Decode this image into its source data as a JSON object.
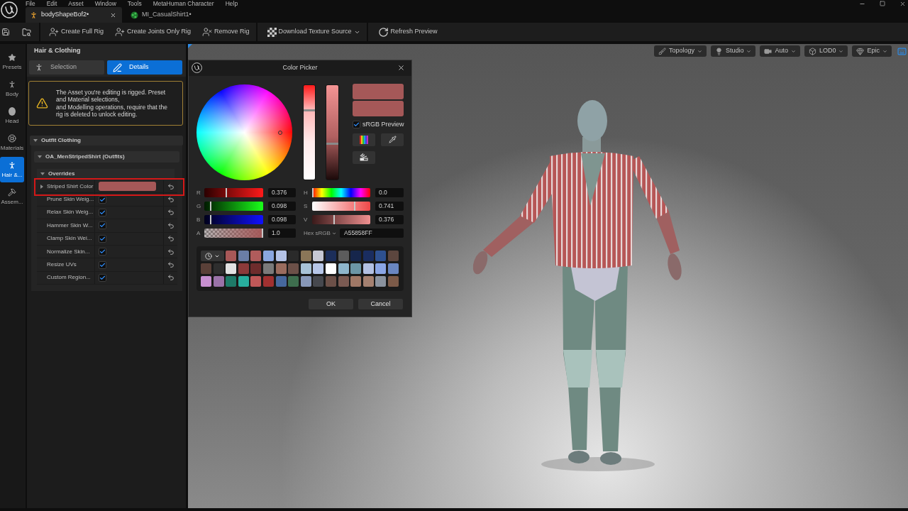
{
  "menu_bar": [
    "File",
    "Edit",
    "Asset",
    "Window",
    "Tools",
    "MetaHuman Character",
    "Help"
  ],
  "document_tabs": [
    {
      "label": "bodyShapeBof2•",
      "kind": "character",
      "selected": true
    },
    {
      "label": "MI_CasualShirt1•",
      "kind": "material",
      "selected": false
    }
  ],
  "toolbar_groups": [
    {
      "buttons": [
        {
          "label": "Create Full Rig",
          "kind": "add_rig"
        },
        {
          "label": "Create Joints Only Rig",
          "kind": "add_rig"
        },
        {
          "label": "Remove Rig",
          "kind": "remove_rig"
        }
      ]
    },
    {
      "buttons": [
        {
          "label": "Download Texture Source",
          "kind": "texture_dropdown"
        }
      ]
    },
    {
      "buttons": [
        {
          "label": "Refresh Preview",
          "kind": "refresh"
        }
      ]
    }
  ],
  "mode_sidebar": [
    {
      "label": "Presets",
      "kind": "presets",
      "selected": false
    },
    {
      "label": "Body",
      "kind": "body",
      "selected": false
    },
    {
      "label": "Head",
      "kind": "head",
      "selected": false
    },
    {
      "label": "Materials",
      "kind": "materials",
      "selected": false
    },
    {
      "label": "Hair &...",
      "kind": "hair_clothing",
      "selected": true
    },
    {
      "label": "Assem...",
      "kind": "assembly",
      "selected": false
    }
  ],
  "panel": {
    "title": "Hair & Clothing",
    "tabs": [
      {
        "label": "Selection",
        "kind": "selection",
        "selected": false
      },
      {
        "label": "Details",
        "kind": "details",
        "selected": true
      }
    ],
    "warning": "The Asset you're editing is rigged. Preset and Material selections,\nand Modelling operations, require that the rig is deleted to unlock editing.",
    "categories": [
      {
        "label": "Outfit Clothing",
        "expanded": true,
        "children": [
          {
            "label": "OA_MenStripedShirt (Outfits)",
            "expanded": true,
            "children": [
              {
                "label": "Overrides",
                "expanded": true,
                "properties": [
                  {
                    "label": "Striped Shirt Color",
                    "kind": "color",
                    "color": "#a55858",
                    "expanded": false,
                    "highlighted": true
                  },
                  {
                    "label": "Prune Skin Weig...",
                    "kind": "checkbox",
                    "checked": true,
                    "highlighted": false
                  },
                  {
                    "label": "Relax Skin Weig...",
                    "kind": "checkbox",
                    "checked": true,
                    "highlighted": false
                  },
                  {
                    "label": "Hammer Skin W...",
                    "kind": "checkbox",
                    "checked": true,
                    "highlighted": false
                  },
                  {
                    "label": "Clamp Skin Wei...",
                    "kind": "checkbox",
                    "checked": true,
                    "highlighted": false
                  },
                  {
                    "label": "Normalize Skin...",
                    "kind": "checkbox",
                    "checked": true,
                    "highlighted": false
                  },
                  {
                    "label": "Resize UVs",
                    "kind": "checkbox",
                    "checked": true,
                    "highlighted": false
                  },
                  {
                    "label": "Custom Region...",
                    "kind": "checkbox",
                    "checked": true,
                    "highlighted": false
                  }
                ]
              }
            ]
          }
        ]
      }
    ]
  },
  "viewport": {
    "toolbar": [
      {
        "label": "Topology",
        "kind": "topology"
      },
      {
        "label": "Studio",
        "kind": "lighting"
      },
      {
        "label": "Auto",
        "kind": "camera"
      },
      {
        "label": "LOD0",
        "kind": "lod"
      },
      {
        "label": "Epic",
        "kind": "quality"
      }
    ]
  },
  "color_picker": {
    "title": "Color Picker",
    "saturation_bar": {
      "level": 0.741
    },
    "value_bar": {
      "level": 0.376
    },
    "previews": [
      {
        "color": "#a55858"
      },
      {
        "color": "#a55858"
      }
    ],
    "srgb_preview": {
      "label": "sRGB Preview",
      "checked": true
    },
    "rgba_sliders": [
      {
        "label": "R",
        "kind": "red",
        "level": 0.376,
        "value": "0.376"
      },
      {
        "label": "G",
        "kind": "green",
        "level": 0.098,
        "value": "0.098"
      },
      {
        "label": "B",
        "kind": "blue",
        "level": 0.098,
        "value": "0.098"
      },
      {
        "label": "A",
        "kind": "alpha",
        "level": 1.0,
        "value": "1.0"
      }
    ],
    "hsv_sliders": [
      {
        "label": "H",
        "kind": "hue",
        "level": 0.0,
        "value": "0.0"
      },
      {
        "label": "S",
        "kind": "saturation",
        "level": 0.741,
        "value": "0.741"
      },
      {
        "label": "V",
        "kind": "value",
        "level": 0.376,
        "value": "0.376"
      }
    ],
    "hex": {
      "label": "Hex sRGB",
      "value": "A55858FF"
    },
    "swatches": [
      {
        "color": "#a85858"
      },
      {
        "color": "#6a7ea6"
      },
      {
        "color": "#b05c5c"
      },
      {
        "color": "#8aa6e0"
      },
      {
        "color": "#b4c2e6"
      },
      {
        "color": "#2a2a2a"
      },
      {
        "color": "#8a7658"
      },
      {
        "color": "#c6c8d4"
      },
      {
        "color": "#1c2e5a"
      },
      {
        "color": "#5c5c5c"
      },
      {
        "color": "#16264c"
      },
      {
        "color": "#1a2d60"
      },
      {
        "color": "#2e5090"
      },
      {
        "color": "#5c463e"
      },
      {
        "color": "#5a4038"
      },
      {
        "color": "#2e2e2e"
      },
      {
        "color": "#e2e2e2"
      },
      {
        "color": "#8c3a3a"
      },
      {
        "color": "#6e2c2c"
      },
      {
        "color": "#7a7a7a"
      },
      {
        "color": "#9a6c5e"
      },
      {
        "color": "#6c5048"
      },
      {
        "color": "#a8c2d6"
      },
      {
        "color": "#b6c6e8"
      },
      {
        "color": "#ffffff"
      },
      {
        "color": "#8eb6cc"
      },
      {
        "color": "#6c96a6"
      },
      {
        "color": "#b2c0e2"
      },
      {
        "color": "#8aa6e6"
      },
      {
        "color": "#6a86c0"
      },
      {
        "color": "#c890d0"
      },
      {
        "color": "#9a72a8"
      },
      {
        "color": "#1e7a68"
      },
      {
        "color": "#28ae9e"
      },
      {
        "color": "#c05858"
      },
      {
        "color": "#a03030"
      },
      {
        "color": "#46689e"
      },
      {
        "color": "#3e6e4e"
      },
      {
        "color": "#8898b8"
      },
      {
        "color": "#46484e"
      },
      {
        "color": "#6c5048"
      },
      {
        "color": "#7a5a52"
      },
      {
        "color": "#a07866"
      },
      {
        "color": "#a48070"
      },
      {
        "color": "#8a929e"
      },
      {
        "color": "#7c5a48"
      }
    ],
    "buttons": [
      "OK",
      "Cancel"
    ]
  }
}
